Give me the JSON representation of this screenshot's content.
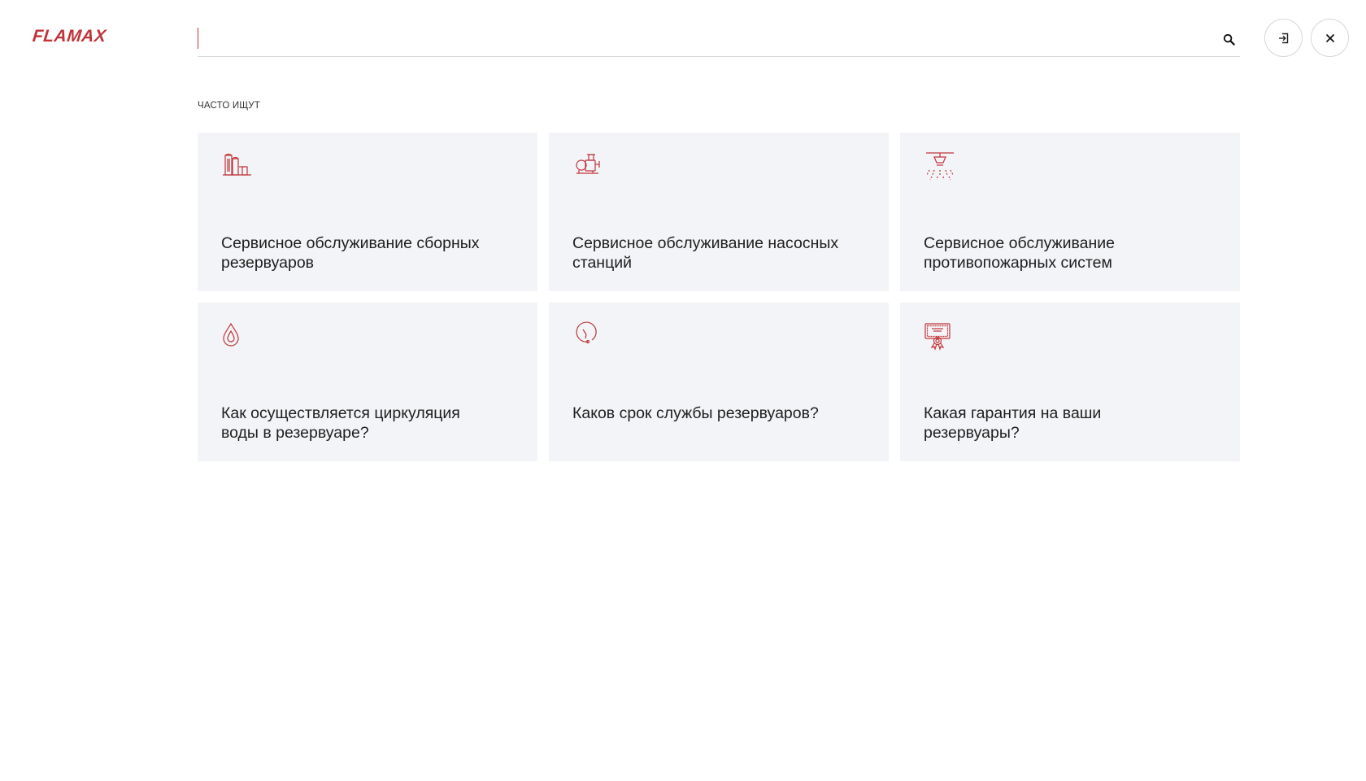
{
  "brand": {
    "logo_text": "FLAMAX",
    "accent_color": "#c0343a"
  },
  "search": {
    "value": "",
    "placeholder": "",
    "button_icon": "search-icon"
  },
  "header_buttons": {
    "login_icon": "login-icon",
    "close_icon": "close-icon"
  },
  "popular": {
    "label": "ЧАСТО ИЩУТ",
    "items": [
      {
        "icon": "tanks-icon",
        "title": "Сервисное обслуживание сборных резервуаров"
      },
      {
        "icon": "pump-icon",
        "title": "Сервисное обслуживание насосных станций"
      },
      {
        "icon": "sprinkler-icon",
        "title": "Сервисное обслуживание противопожарных систем"
      },
      {
        "icon": "water-drop-icon",
        "title": "Как осуществляется циркуляция воды в резервуаре?"
      },
      {
        "icon": "clock-icon",
        "title": "Каков срок службы резервуаров?"
      },
      {
        "icon": "certificate-icon",
        "title": "Какая гарантия на ваши резервуары?"
      }
    ]
  }
}
